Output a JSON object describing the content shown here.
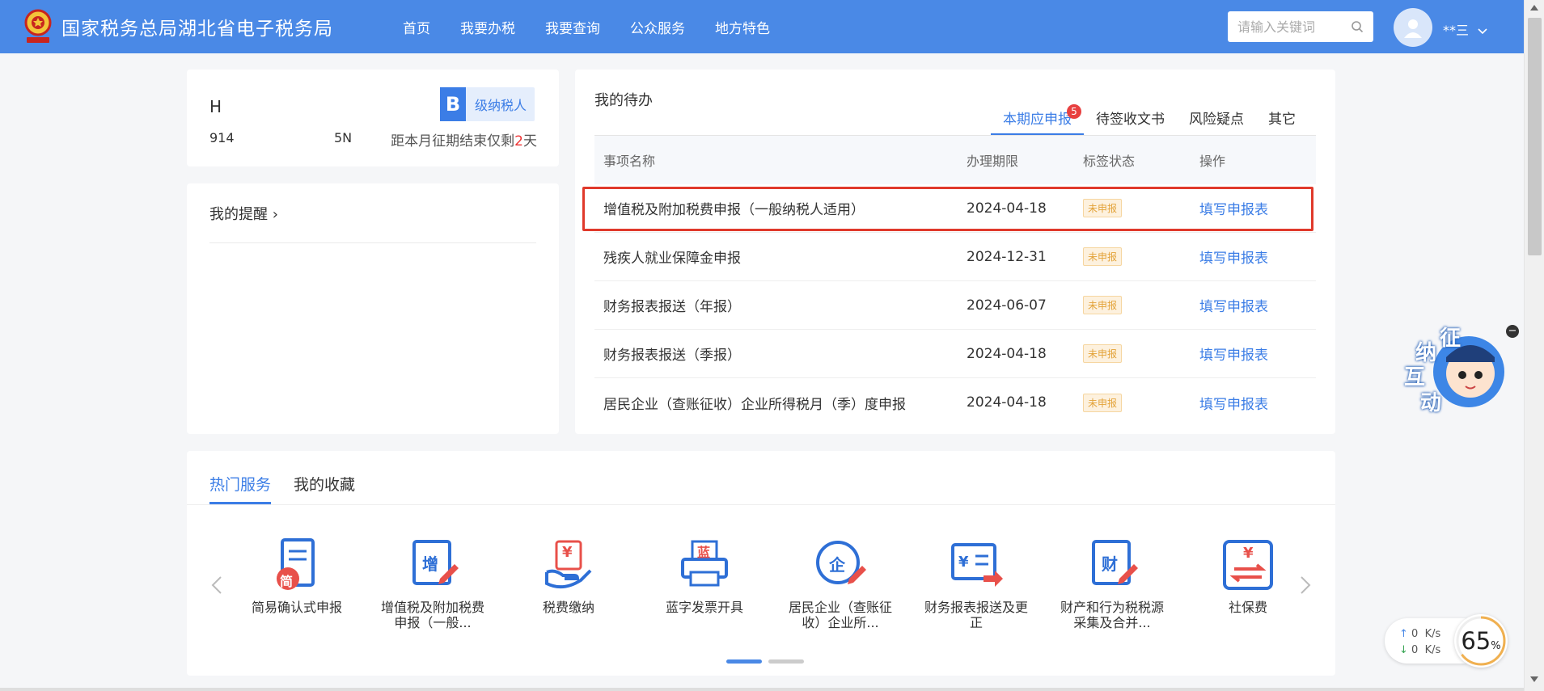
{
  "header": {
    "title": "国家税务总局湖北省电子税务局",
    "nav": [
      "首页",
      "我要办税",
      "我要查询",
      "公众服务",
      "地方特色"
    ],
    "search_placeholder": "请输入关键词",
    "username": "**三",
    "brand_color": "#4a89e6"
  },
  "taxpayer": {
    "name_visible": "H",
    "id_start": "914",
    "id_end": "5N",
    "level_letter": "B",
    "level_text": "级纳税人",
    "deadline_prefix": "距本月征期结束仅剩",
    "deadline_days": "2",
    "deadline_suffix": "天"
  },
  "reminder": {
    "title": "我的提醒 ›"
  },
  "todo": {
    "title": "我的待办",
    "tabs": [
      {
        "label": "本期应申报",
        "badge": "5"
      },
      {
        "label": "待签收文书"
      },
      {
        "label": "风险疑点"
      },
      {
        "label": "其它"
      }
    ],
    "columns": [
      "事项名称",
      "办理期限",
      "标签状态",
      "操作"
    ],
    "rows": [
      {
        "name": "增值税及附加税费申报（一般纳税人适用）",
        "date": "2024-04-18",
        "status": "未申报",
        "action": "填写申报表"
      },
      {
        "name": "残疾人就业保障金申报",
        "date": "2024-12-31",
        "status": "未申报",
        "action": "填写申报表"
      },
      {
        "name": "财务报表报送（年报）",
        "date": "2024-06-07",
        "status": "未申报",
        "action": "填写申报表"
      },
      {
        "name": "财务报表报送（季报）",
        "date": "2024-04-18",
        "status": "未申报",
        "action": "填写申报表"
      },
      {
        "name": "居民企业（查账征收）企业所得税月（季）度申报",
        "date": "2024-04-18",
        "status": "未申报",
        "action": "填写申报表"
      }
    ],
    "highlight_color": "#e0392b"
  },
  "services": {
    "tabs": [
      "热门服务",
      "我的收藏"
    ],
    "items": [
      {
        "label": "简易确认式申报",
        "icon": "scroll-simple-icon",
        "glyph": "简"
      },
      {
        "label": "增值税及附加税费申报（一般...",
        "icon": "vat-declare-icon",
        "glyph": "增"
      },
      {
        "label": "税费缴纳",
        "icon": "tax-payment-icon",
        "glyph": "¥"
      },
      {
        "label": "蓝字发票开具",
        "icon": "invoice-printer-icon",
        "glyph": "蓝"
      },
      {
        "label": "居民企业（查账征收）企业所...",
        "icon": "enterprise-tax-icon",
        "glyph": "企"
      },
      {
        "label": "财务报表报送及更正",
        "icon": "financial-report-icon",
        "glyph": "¥"
      },
      {
        "label": "财产和行为税税源采集及合并...",
        "icon": "property-tax-icon",
        "glyph": "财"
      },
      {
        "label": "社保费",
        "icon": "social-security-icon",
        "glyph": "¥"
      }
    ]
  },
  "mascot": {
    "chars": [
      "征",
      "纳",
      "互",
      "动"
    ]
  },
  "netspeed": {
    "up": "0",
    "down": "0",
    "unit": "K/s",
    "percent": "65",
    "percent_sign": "%"
  }
}
